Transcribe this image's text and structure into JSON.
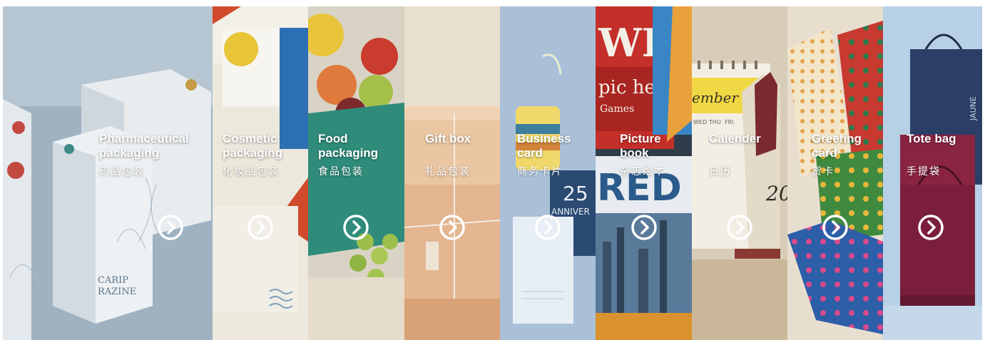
{
  "panels": [
    {
      "title_lines": [
        "Pharmaceutical",
        "packaging"
      ],
      "subtitle": "药品包装",
      "arrow_icon": "chevron-right-circle"
    },
    {
      "title_lines": [
        "Cosmetic",
        "packaging"
      ],
      "subtitle": "化妆品包装",
      "arrow_icon": "chevron-right-circle"
    },
    {
      "title_lines": [
        "Food",
        "packaging"
      ],
      "subtitle": "食品包装",
      "arrow_icon": "chevron-right-circle"
    },
    {
      "title_lines": [
        "Gift box"
      ],
      "subtitle": "礼品包装",
      "arrow_icon": "chevron-right-circle"
    },
    {
      "title_lines": [
        "Business",
        "card"
      ],
      "subtitle": "商务卡片",
      "arrow_icon": "chevron-right-circle"
    },
    {
      "title_lines": [
        "Picture",
        "book"
      ],
      "subtitle": "杂志绘本",
      "arrow_icon": "chevron-right-circle"
    },
    {
      "title_lines": [
        "Calender"
      ],
      "subtitle": "日历",
      "arrow_icon": "chevron-right-circle"
    },
    {
      "title_lines": [
        "Greeting",
        "card"
      ],
      "subtitle": "贺卡",
      "arrow_icon": "chevron-right-circle"
    },
    {
      "title_lines": [
        "Tote bag"
      ],
      "subtitle": "手提袋",
      "arrow_icon": "chevron-right-circle"
    }
  ],
  "artwork_text": {
    "pharma_box": [
      "CARIP",
      "RAZINE"
    ],
    "magazine": [
      "WE",
      "pic he",
      "Games",
      "RED"
    ],
    "anniversary": [
      "25",
      "ANNIVER"
    ],
    "calendar_month": "ember",
    "calendar_days": [
      "WED",
      "THU",
      "FRI"
    ],
    "calendar_year": "20",
    "tote_brand": "JAUNE"
  },
  "colors": {
    "caption_text": "#ffffff",
    "arrow_ring": "#ffffff"
  }
}
